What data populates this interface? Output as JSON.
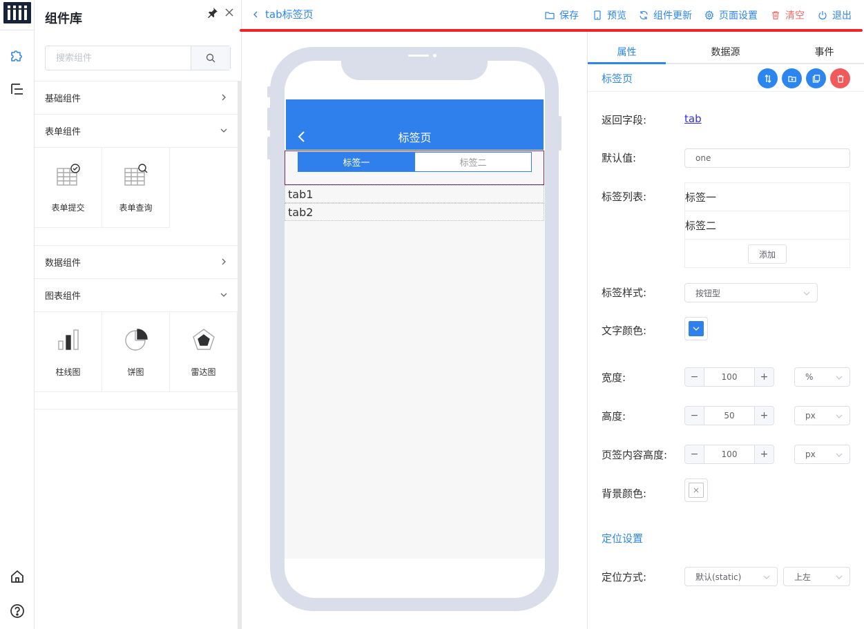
{
  "sidebar": {
    "icons": [
      "component-library-icon",
      "outline-tree-icon",
      "home-icon",
      "help-icon"
    ]
  },
  "panel": {
    "title": "组件库",
    "search": {
      "placeholder": "搜索组件",
      "value": ""
    },
    "groups": [
      {
        "label": "基础组件",
        "expanded": false
      },
      {
        "label": "表单组件",
        "expanded": true,
        "items": [
          "表单提交",
          "表单查询"
        ]
      },
      {
        "label": "数据组件",
        "expanded": false
      },
      {
        "label": "图表组件",
        "expanded": true,
        "items": [
          "柱线图",
          "饼图",
          "雷达图"
        ]
      }
    ]
  },
  "topbar": {
    "page_name": "tab标签页",
    "actions": [
      "保存",
      "预览",
      "组件更新",
      "页面设置",
      "清空",
      "退出"
    ]
  },
  "phone": {
    "nav_title": "标签页",
    "tabs": [
      "标签一",
      "标签二"
    ],
    "active_tab": 0,
    "rows": [
      "tab1",
      "tab2"
    ]
  },
  "props": {
    "tabs": [
      "属性",
      "数据源",
      "事件"
    ],
    "active_tab": 0,
    "component_name": "标签页",
    "fields": {
      "return_field": {
        "label": "返回字段:",
        "value": "tab"
      },
      "default_value": {
        "label": "默认值:",
        "value": "one"
      },
      "tab_list": {
        "label": "标签列表:",
        "items": [
          "标签一",
          "标签二"
        ],
        "add_label": "添加"
      },
      "tab_style": {
        "label": "标签样式:",
        "value": "按钮型"
      },
      "text_color": {
        "label": "文字颜色:",
        "value": "#2f80ed"
      },
      "width": {
        "label": "宽度:",
        "value": "100",
        "unit": "%"
      },
      "height": {
        "label": "高度:",
        "value": "50",
        "unit": "px"
      },
      "content_height": {
        "label": "页签内容高度:",
        "value": "100",
        "unit": "px"
      },
      "bg_color": {
        "label": "背景颜色:",
        "value": "none"
      }
    },
    "position": {
      "title": "定位设置",
      "mode": {
        "label": "定位方式:",
        "value": "默认(static)",
        "anchor": "上左"
      }
    }
  },
  "colors": {
    "accent": "#2d86f0",
    "phone_header": "#2f80ed",
    "danger": "#f56c6c",
    "highlight_border": "#f0232d"
  }
}
